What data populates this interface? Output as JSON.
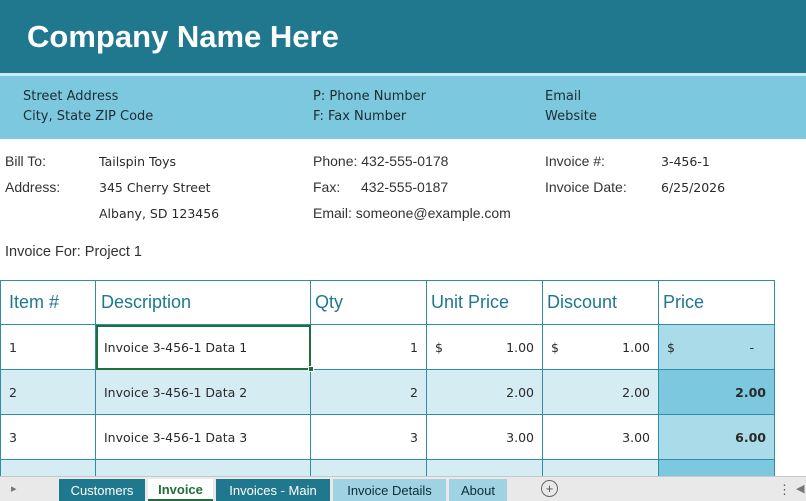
{
  "header": {
    "company_name": "Company Name Here",
    "street": "Street Address",
    "city": "City, State ZIP Code",
    "phone": "P: Phone Number",
    "fax": "F: Fax Number",
    "email": "Email",
    "website": "Website"
  },
  "bill_to": {
    "bill_to_label": "Bill To:",
    "bill_to_value": "Tailspin Toys",
    "address_label": "Address:",
    "address_line1": "345 Cherry Street",
    "address_line2": "Albany, SD 123456"
  },
  "contact": {
    "phone_label": "Phone: 432-555-0178",
    "fax_label": "Fax:",
    "fax_value": "432-555-0187",
    "email_label": "Email: someone@example.com"
  },
  "invoice_meta": {
    "invoice_no_label": "Invoice #:",
    "invoice_no_value": "3-456-1",
    "invoice_date_label": "Invoice Date:",
    "invoice_date_value": "6/25/2026"
  },
  "invoice_for": "Invoice For: Project 1",
  "table": {
    "headers": [
      "Item #",
      "Description",
      "Qty",
      "Unit Price",
      "Discount",
      "Price"
    ],
    "rows": [
      {
        "item": "1",
        "description": "Invoice 3-456-1 Data 1",
        "qty": "1",
        "unit_currency": "$",
        "unit_price": "1.00",
        "discount_currency": "$",
        "discount": "1.00",
        "price_currency": "$",
        "price": "-"
      },
      {
        "item": "2",
        "description": "Invoice 3-456-1 Data 2",
        "qty": "2",
        "unit_price": "2.00",
        "discount": "2.00",
        "price": "2.00"
      },
      {
        "item": "3",
        "description": "Invoice 3-456-1 Data 3",
        "qty": "3",
        "unit_price": "3.00",
        "discount": "3.00",
        "price": "6.00"
      }
    ]
  },
  "sheet_tabs": [
    "Customers",
    "Invoice",
    "Invoices - Main",
    "Invoice Details",
    "About"
  ],
  "active_tab": "Invoice",
  "icons": {
    "scroll_left": "triangle-left-icon",
    "add_sheet": "plus-circle-icon",
    "options": "vertical-ellipsis-icon"
  },
  "colors": {
    "title_bar": "#20788f",
    "address_band": "#7cc9df",
    "alt_row": "#d5ecf3",
    "selection": "#1e6e3e"
  }
}
